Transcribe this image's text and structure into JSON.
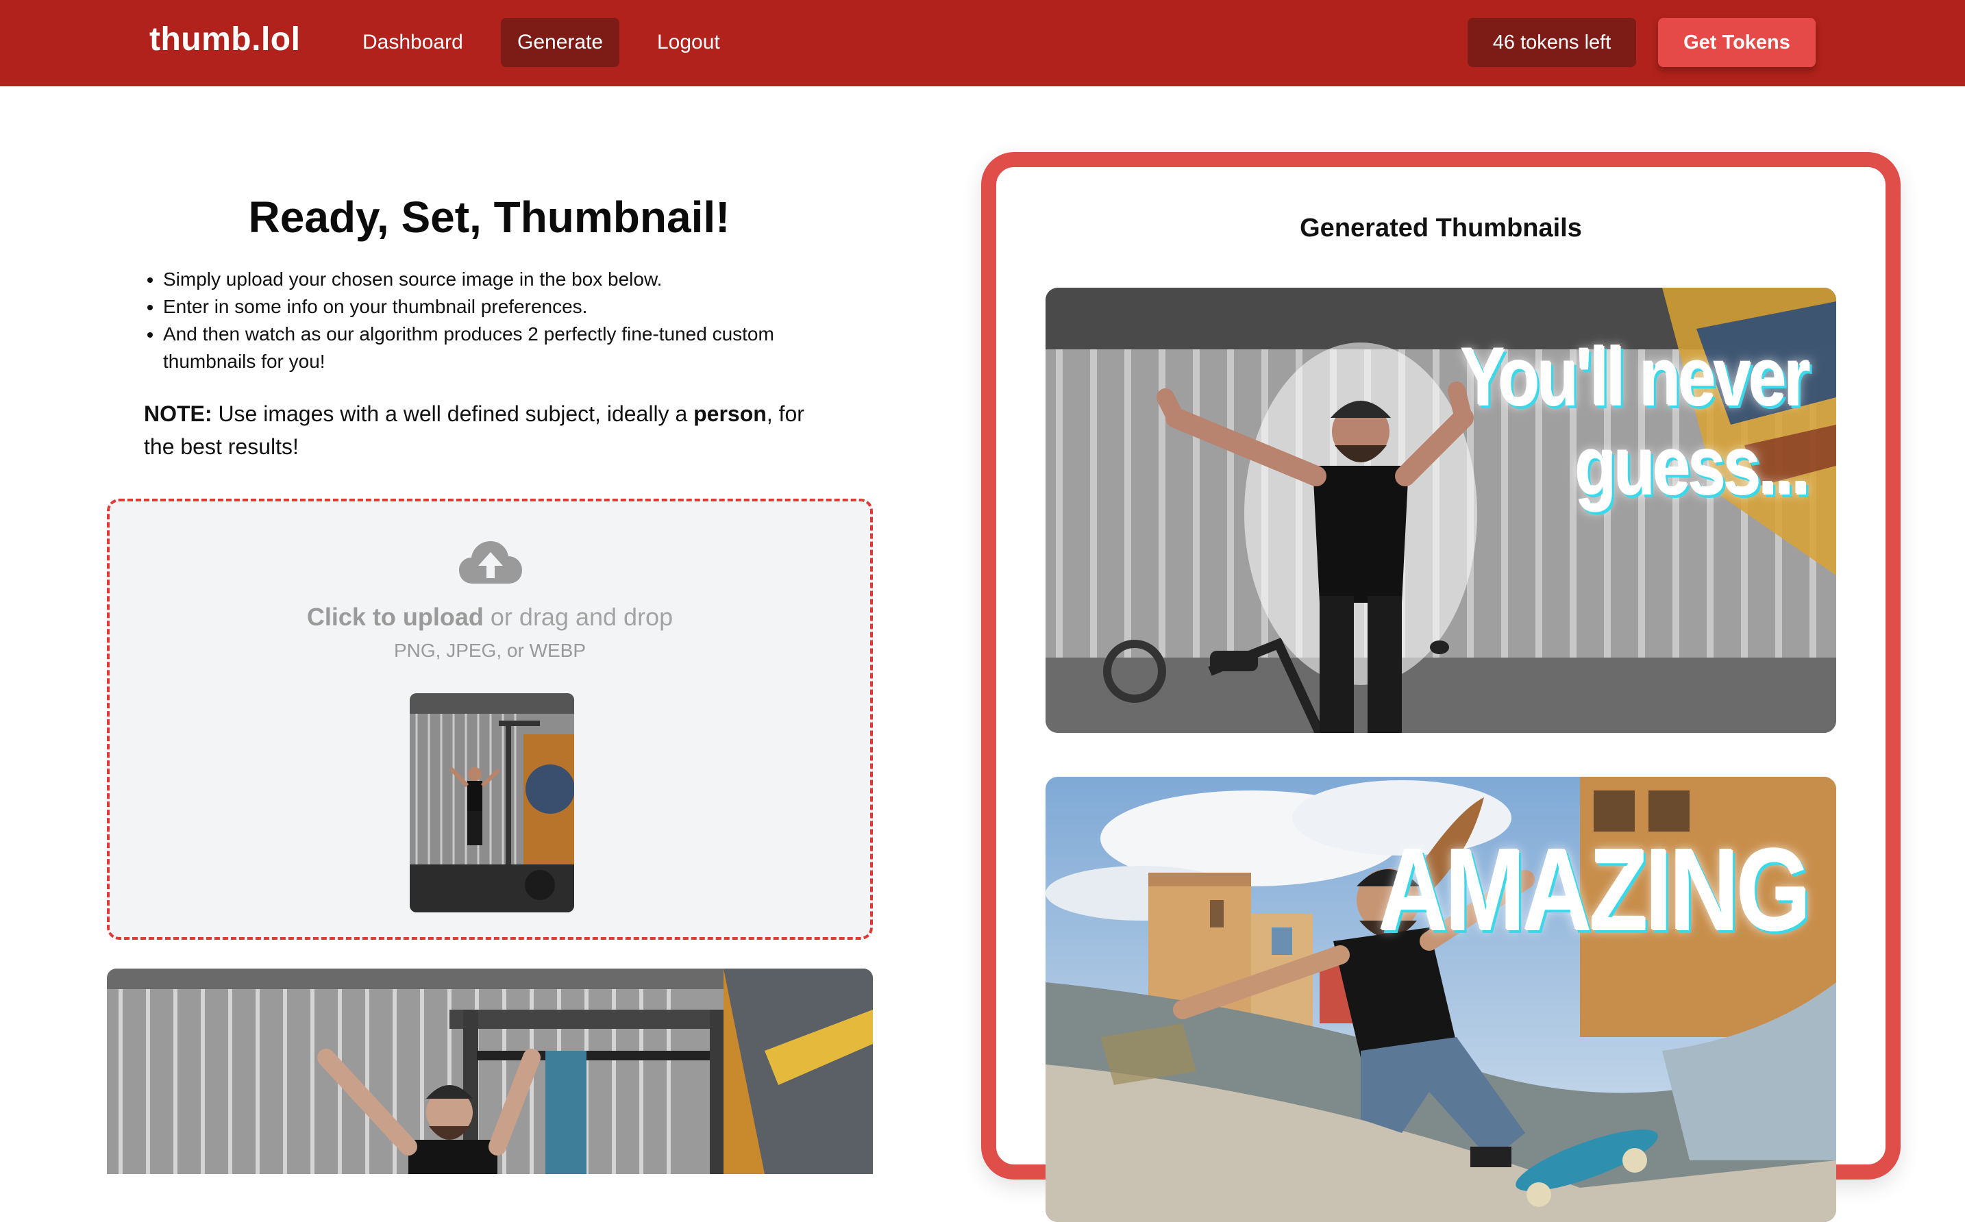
{
  "nav": {
    "brand": "thumb.lol",
    "links": [
      "Dashboard",
      "Generate",
      "Logout"
    ],
    "active": "Generate",
    "tokens": "46 tokens left",
    "get_tokens": "Get Tokens"
  },
  "colors": {
    "navbar": "#b0221b",
    "accent": "#e04e4a",
    "dark_accent": "#7d1b16",
    "dropzone_bg": "#f3f4f6"
  },
  "main": {
    "title": "Ready, Set, Thumbnail!",
    "steps": [
      "Simply upload your chosen source image in the box below.",
      "Enter in some info on your thumbnail preferences.",
      "And then watch as our algorithm produces 2 perfectly fine-tuned custom thumbnails for you!"
    ],
    "note_label": "NOTE:",
    "note_text_1": " Use images with a well defined subject, ideally a ",
    "note_bold": "person",
    "note_text_2": ", for the best results!"
  },
  "upload": {
    "icon": "cloud-upload-icon",
    "click_label": "Click to upload",
    "drag_label": " or drag and drop",
    "formats": "PNG, JPEG, or WEBP"
  },
  "generated": {
    "title": "Generated Thumbnails",
    "thumbnails": [
      {
        "caption_line1": "You'll never",
        "caption_line2": "guess..."
      },
      {
        "caption_line1": "AMAZING",
        "caption_line2": ""
      }
    ]
  }
}
